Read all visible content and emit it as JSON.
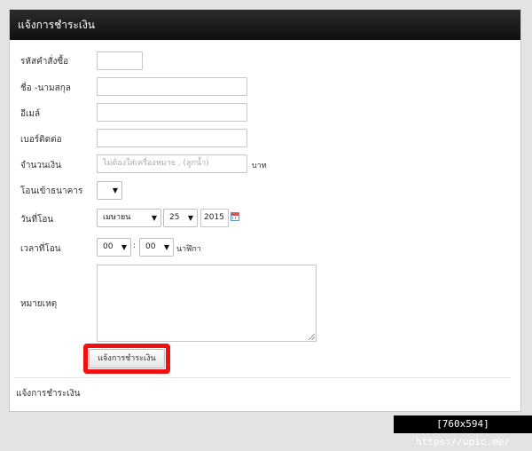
{
  "panel": {
    "title": "แจ้งการชำระเงิน",
    "footer": "แจ้งการชำระเงิน"
  },
  "form": {
    "order_id": {
      "label": "รหัสคำสั่งซื้อ",
      "value": ""
    },
    "name": {
      "label": "ชื่อ -นามสกุล",
      "value": ""
    },
    "email": {
      "label": "อีเมล์",
      "value": ""
    },
    "phone": {
      "label": "เบอร์ติดต่อ",
      "value": ""
    },
    "amount": {
      "label": "จำนวนเงิน",
      "placeholder": "ไม่ต้องใส่เครื่องหมาย , (ลูกน้ำ)",
      "suffix": "บาท"
    },
    "bank": {
      "label": "โอนเข้าธนาคาร",
      "value": ""
    },
    "transfer_date": {
      "label": "วันที่โอน",
      "month": "เมษายน",
      "day": "25",
      "year": "2015"
    },
    "transfer_time": {
      "label": "เวลาที่โอน",
      "hour": "00",
      "separator": ":",
      "minute": "00",
      "suffix": "นาฬิกา"
    },
    "note": {
      "label": "หมายเหตุ",
      "value": ""
    },
    "submit_label": "แจ้งการชำระเงิน"
  },
  "caret_glyph": "▼",
  "watermark": "[760x594] https://upic.me/",
  "colors": {
    "header_bg": "#141414",
    "highlight": "#ee1111",
    "page_bg": "#e3e3e3"
  },
  "icons": {
    "calendar": "calendar-icon"
  }
}
